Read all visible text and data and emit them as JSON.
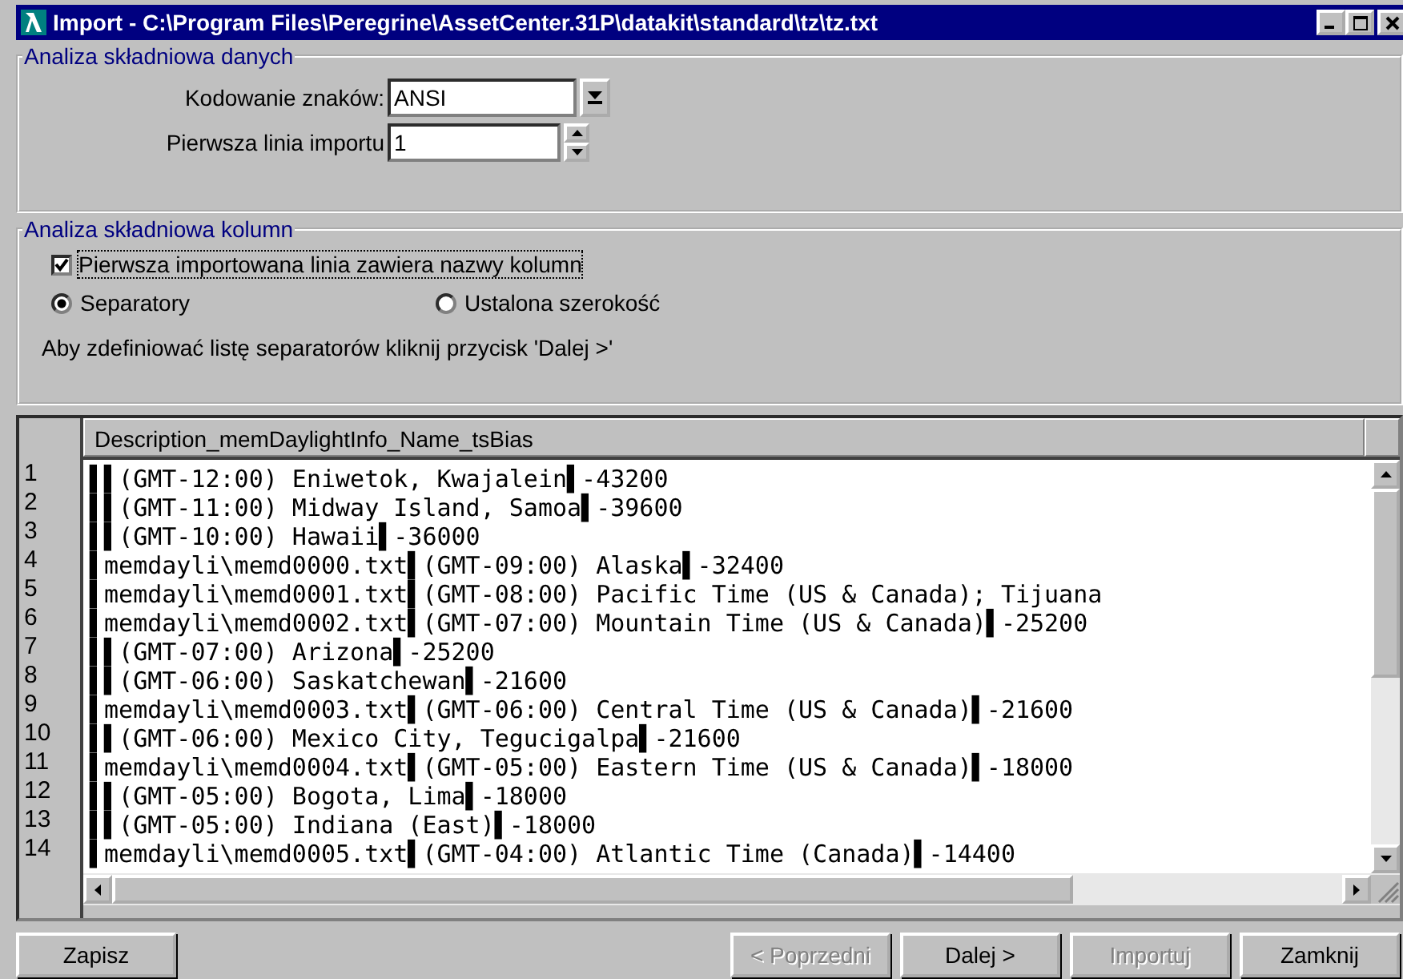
{
  "window": {
    "title": "Import - C:\\Program Files\\Peregrine\\AssetCenter.31P\\datakit\\standard\\tz\\tz.txt"
  },
  "data_parsing": {
    "legend": "Analiza składniowa danych",
    "encoding_label": "Kodowanie znaków:",
    "encoding_value": "ANSI",
    "first_line_label": "Pierwsza linia importu",
    "first_line_value": "1"
  },
  "column_parsing": {
    "legend": "Analiza składniowa kolumn",
    "header_checkbox": {
      "label": "Pierwsza importowana linia zawiera nazwy kolumn",
      "checked": true
    },
    "modes": [
      {
        "label": "Separatory",
        "selected": true
      },
      {
        "label": "Ustalona szerokość",
        "selected": false
      }
    ],
    "hint": "Aby zdefiniować listę separatorów kliknij przycisk 'Dalej >'"
  },
  "preview": {
    "column_header": "Description_memDaylightInfo_Name_tsBias",
    "rows": [
      {
        "number": "1",
        "text": "▌▌(GMT-12:00) Eniwetok, Kwajalein▌-43200"
      },
      {
        "number": "2",
        "text": "▌▌(GMT-11:00) Midway Island, Samoa▌-39600"
      },
      {
        "number": "3",
        "text": "▌▌(GMT-10:00) Hawaii▌-36000"
      },
      {
        "number": "4",
        "text": "▌memdayli\\memd0000.txt▌(GMT-09:00) Alaska▌-32400"
      },
      {
        "number": "5",
        "text": "▌memdayli\\memd0001.txt▌(GMT-08:00) Pacific Time (US & Canada); Tijuana"
      },
      {
        "number": "6",
        "text": "▌memdayli\\memd0002.txt▌(GMT-07:00) Mountain Time (US & Canada)▌-25200"
      },
      {
        "number": "7",
        "text": "▌▌(GMT-07:00) Arizona▌-25200"
      },
      {
        "number": "8",
        "text": "▌▌(GMT-06:00) Saskatchewan▌-21600"
      },
      {
        "number": "9",
        "text": "▌memdayli\\memd0003.txt▌(GMT-06:00) Central Time (US & Canada)▌-21600"
      },
      {
        "number": "10",
        "text": "▌▌(GMT-06:00) Mexico City, Tegucigalpa▌-21600"
      },
      {
        "number": "11",
        "text": "▌memdayli\\memd0004.txt▌(GMT-05:00) Eastern Time (US & Canada)▌-18000"
      },
      {
        "number": "12",
        "text": "▌▌(GMT-05:00) Bogota, Lima▌-18000"
      },
      {
        "number": "13",
        "text": "▌▌(GMT-05:00) Indiana (East)▌-18000"
      },
      {
        "number": "14",
        "text": "▌memdayli\\memd0005.txt▌(GMT-04:00) Atlantic Time (Canada)▌-14400"
      }
    ]
  },
  "buttons": [
    {
      "label": "Zapisz",
      "disabled": false
    },
    {
      "label": "< Poprzedni",
      "disabled": true
    },
    {
      "label": "Dalej >",
      "disabled": false
    },
    {
      "label": "Importuj",
      "disabled": true
    },
    {
      "label": "Zamknij",
      "disabled": false
    }
  ]
}
